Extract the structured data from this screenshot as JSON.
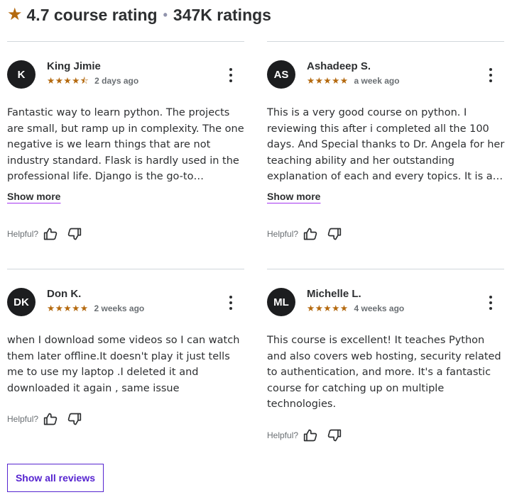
{
  "header": {
    "rating": "4.7 course rating",
    "separator": "•",
    "count": "347K ratings"
  },
  "reviews": [
    {
      "initials": "K",
      "name": "King Jimie",
      "stars": "★★★★⯪",
      "rating": 4.5,
      "date": "2 days ago",
      "text": "Fantastic way to learn python. The projects are small, but ramp up in complexity. The one negative is we learn things that are not industry standard. Flask is hardly used in the professional life. Django is the go-to…",
      "show_more": "Show more",
      "helpful": "Helpful?"
    },
    {
      "initials": "AS",
      "name": "Ashadeep S.",
      "stars": "★★★★★",
      "rating": 5,
      "date": "a week ago",
      "text": "This is a very good course on python. I reviewing this after i completed all the 100 days. And Special thanks to Dr. Angela for her teaching ability and her outstanding explanation of each and every topics. It is a…",
      "show_more": "Show more",
      "helpful": "Helpful?"
    },
    {
      "initials": "DK",
      "name": "Don K.",
      "stars": "★★★★★",
      "rating": 5,
      "date": "2 weeks ago",
      "text": "when I download some videos so I can watch them later offline.It doesn't play it just tells me to use my laptop .I deleted it and downloaded it again , same issue",
      "helpful": "Helpful?"
    },
    {
      "initials": "ML",
      "name": "Michelle L.",
      "stars": "★★★★★",
      "rating": 5,
      "date": "4 weeks ago",
      "text": "This course is excellent! It teaches Python and also covers web hosting, security related to authentication, and more. It's a fantastic course for catching up on multiple technologies.",
      "helpful": "Helpful?"
    }
  ],
  "show_all_label": "Show all reviews",
  "colors": {
    "star": "#b4690e",
    "avatar_bg": "#1c1d1f",
    "accent": "#5624d0",
    "divider": "#d1d7dc"
  },
  "icons": {
    "header_star": "star-icon",
    "menu": "more-vertical-icon",
    "like": "thumbs-up-icon",
    "dislike": "thumbs-down-icon"
  }
}
